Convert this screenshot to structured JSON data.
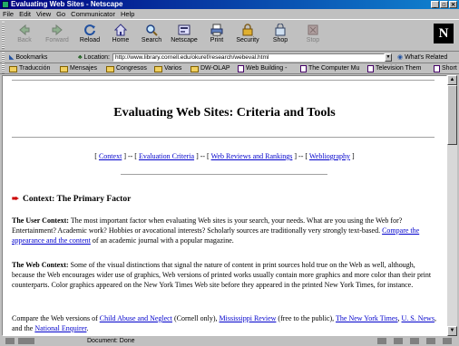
{
  "window": {
    "title": "Evaluating Web Sites - Netscape"
  },
  "menu": [
    "File",
    "Edit",
    "View",
    "Go",
    "Communicator",
    "Help"
  ],
  "toolbar": [
    {
      "label": "Back",
      "icon": "back-arrow-icon",
      "enabled": false
    },
    {
      "label": "Forward",
      "icon": "forward-arrow-icon",
      "enabled": false
    },
    {
      "label": "Reload",
      "icon": "reload-icon",
      "enabled": true
    },
    {
      "label": "Home",
      "icon": "home-icon",
      "enabled": true
    },
    {
      "label": "Search",
      "icon": "search-icon",
      "enabled": true
    },
    {
      "label": "Netscape",
      "icon": "netscape-icon",
      "enabled": true
    },
    {
      "label": "Print",
      "icon": "print-icon",
      "enabled": true
    },
    {
      "label": "Security",
      "icon": "security-lock-icon",
      "enabled": true
    },
    {
      "label": "Shop",
      "icon": "shop-icon",
      "enabled": true
    },
    {
      "label": "Stop",
      "icon": "stop-icon",
      "enabled": false
    }
  ],
  "location": {
    "bookmarks_label": "Bookmarks",
    "location_label": "Location:",
    "url": "http://www.library.cornell.edu/okuref/research/webeval.html",
    "related_label": "What's Related"
  },
  "personal_bar": [
    {
      "label": "Traducción",
      "kind": "folder"
    },
    {
      "label": "Mensajes",
      "kind": "folder"
    },
    {
      "label": "Congresos",
      "kind": "folder"
    },
    {
      "label": "Varios",
      "kind": "folder"
    },
    {
      "label": "DW-OLAP",
      "kind": "folder"
    },
    {
      "label": "Web Building -",
      "kind": "page"
    },
    {
      "label": "The Computer Mu",
      "kind": "page"
    },
    {
      "label": "Television Them",
      "kind": "page"
    },
    {
      "label": "Short",
      "kind": "page"
    }
  ],
  "page": {
    "title": "Evaluating Web Sites: Criteria and Tools",
    "nav": {
      "context": "Context",
      "criteria": "Evaluation Criteria",
      "reviews": "Web Reviews and Rankings",
      "webliography": "Webliography",
      "open": "[",
      "sep": "] -- [",
      "close": "]"
    },
    "section_heading": "Context: The Primary Factor",
    "user_context": {
      "label": "The User Context:",
      "text": "The most important factor when evaluating Web sites is your search, your needs. What are you using the Web for? Entertainment? Academic work? Hobbies or avocational interests? Scholarly sources are traditionally very strongly text-based.",
      "link": "Compare the appearance and the content",
      "tail": "of an academic journal with a popular magazine."
    },
    "web_context": {
      "label": "The Web Context:",
      "text": "Some of the visual distinctions that signal the nature of content in print sources hold true on the Web as well, although, because the Web encourages wider use of graphics, Web versions of printed works usually contain more graphics and more color than their print counterparts. Color graphics appeared on the New York Times Web site before they appeared in the printed New York Times, for instance."
    },
    "compare": {
      "lead": "Compare the Web versions of",
      "link1": "Child Abuse and Neglect",
      "note1": "(Cornell only),",
      "link2": "Mississippi Review",
      "note2": "(free to the public),",
      "link3": "The New York Times",
      "sep3": ",",
      "link4": "U. S. News",
      "and": ", and the",
      "link5": "National Enquirer",
      "end": "."
    }
  },
  "status": {
    "text": "Document: Done"
  }
}
